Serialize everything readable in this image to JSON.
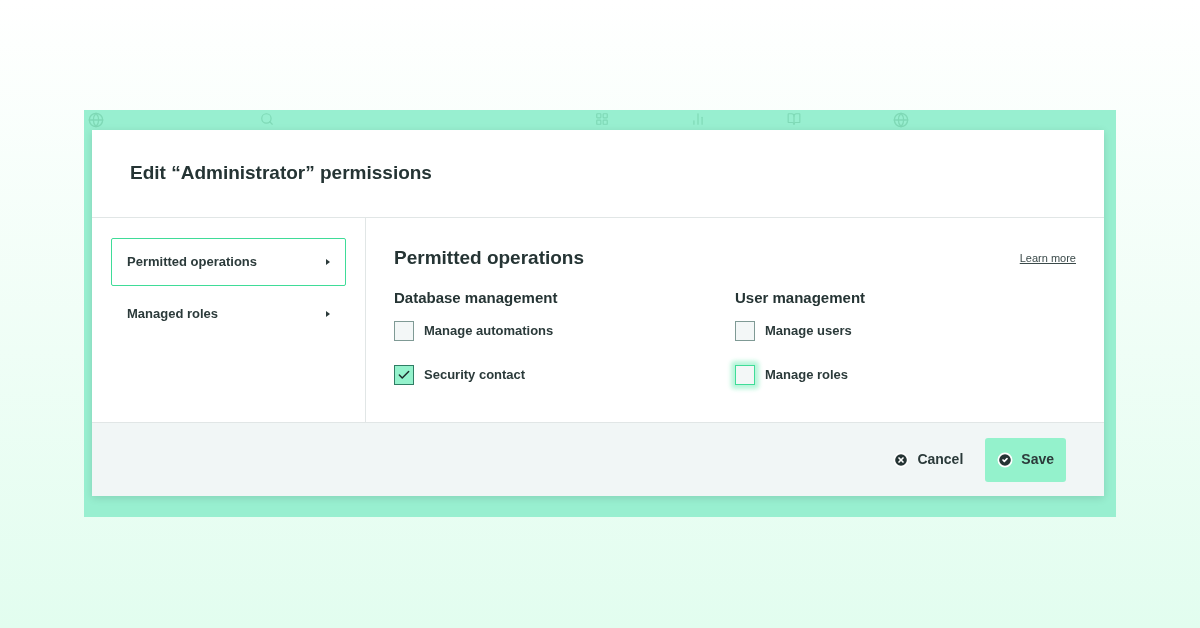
{
  "dialog": {
    "title": "Edit “Administrator” permissions",
    "nav": [
      {
        "label": "Permitted operations",
        "selected": true
      },
      {
        "label": "Managed roles",
        "selected": false
      }
    ],
    "heading": "Permitted operations",
    "learn_more": "Learn more",
    "groups": [
      {
        "title": "Database management",
        "options": [
          {
            "label": "Manage automations",
            "checked": false,
            "focused": false
          },
          {
            "label": "Security contact",
            "checked": true,
            "focused": false
          }
        ]
      },
      {
        "title": "User management",
        "options": [
          {
            "label": "Manage users",
            "checked": false,
            "focused": false
          },
          {
            "label": "Manage roles",
            "checked": false,
            "focused": true
          }
        ]
      }
    ],
    "buttons": {
      "cancel": "Cancel",
      "save": "Save"
    }
  }
}
